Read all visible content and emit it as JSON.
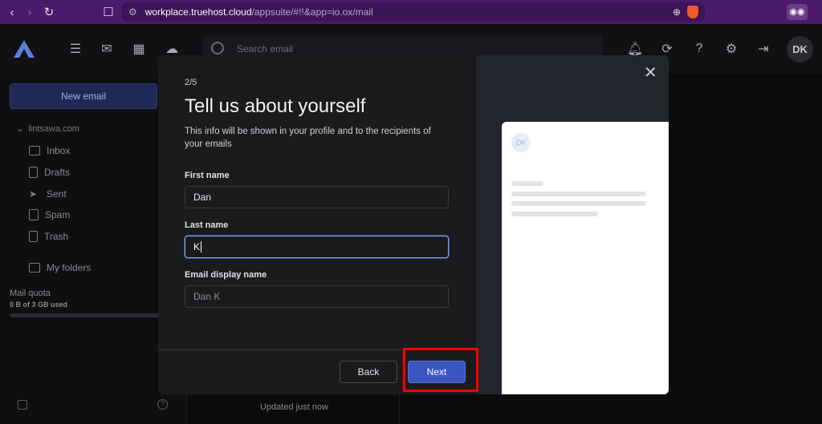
{
  "browser": {
    "url_host": "workplace.truehost.cloud",
    "url_path": "/appsuite/#!!&app=io.ox/mail"
  },
  "header": {
    "search_placeholder": "Search email",
    "avatar_initials": "DK"
  },
  "sidebar": {
    "new_email_label": "New email",
    "account": "lintsawa.com",
    "folders": [
      {
        "label": "Inbox",
        "icon": "inbox-icon"
      },
      {
        "label": "Drafts",
        "icon": "drafts-icon"
      },
      {
        "label": "Sent",
        "icon": "sent-icon"
      },
      {
        "label": "Spam",
        "icon": "spam-icon"
      },
      {
        "label": "Trash",
        "icon": "trash-icon"
      }
    ],
    "my_folders_label": "My folders",
    "quota_label": "Mail quota",
    "quota_value": "0 B of 3 GB used"
  },
  "status": {
    "updated": "Updated just now"
  },
  "modal": {
    "step": "2/5",
    "title": "Tell us about yourself",
    "description": "This info will be shown in your profile and to the recipients of your emails",
    "first_name_label": "First name",
    "first_name_value": "Dan",
    "last_name_label": "Last name",
    "last_name_value": "K",
    "display_name_label": "Email display name",
    "display_name_placeholder": "Dan K",
    "back_label": "Back",
    "next_label": "Next",
    "preview_avatar": "DK"
  },
  "colors": {
    "accent": "#3a55c0",
    "highlight": "#ff0000",
    "browser_bar": "#4a1a6b"
  }
}
